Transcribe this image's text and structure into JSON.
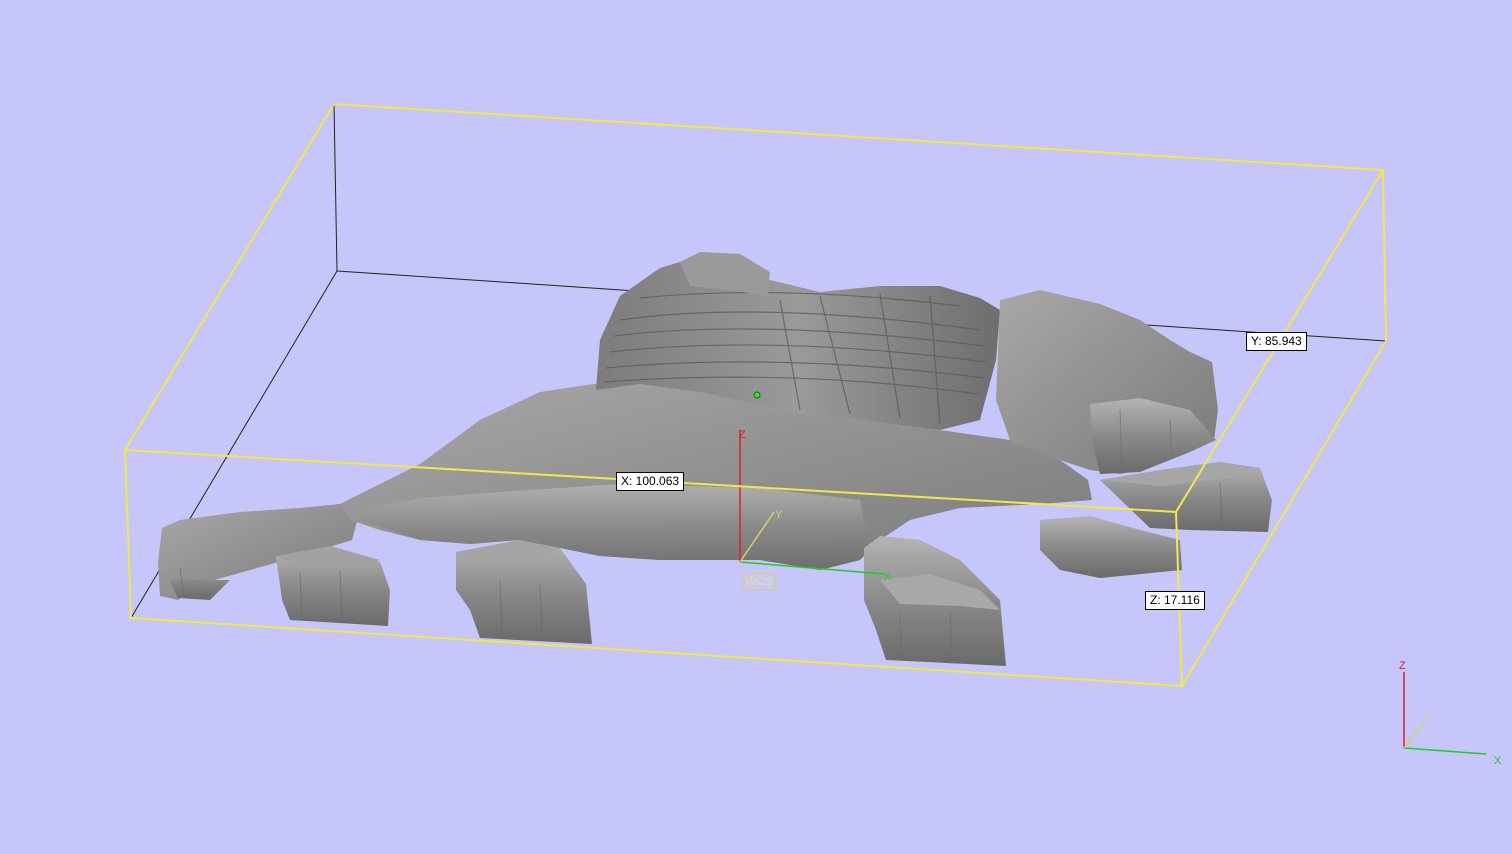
{
  "viewport": {
    "background_color": "#c6c6fa",
    "bounding_box_color": "#f0e84c",
    "model_color": "#8c8c8c"
  },
  "dimensions": {
    "x_label": "X: 100.063",
    "y_label": "Y: 85.943",
    "z_label": "Z: 17.116"
  },
  "wcs": {
    "label": "WCS",
    "axis_x": "X",
    "axis_y": "Y",
    "axis_z": "Z",
    "x_color": "#22cc22",
    "y_color": "#d8d060",
    "z_color": "#dd2222"
  },
  "orientation_triad": {
    "axis_x": "X",
    "axis_y": "Y",
    "axis_z": "Z",
    "x_color": "#22cc22",
    "y_color": "#d8d060",
    "z_color": "#dd2222"
  }
}
